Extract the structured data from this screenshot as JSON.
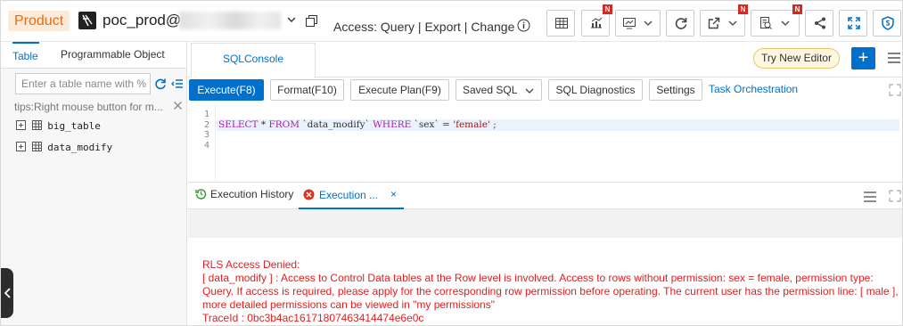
{
  "header": {
    "product_label": "Product",
    "database_name": "poc_prod@",
    "access_label": "Access:",
    "access_value": "Query | Export | Change",
    "new_badge": "N"
  },
  "left_panel": {
    "tabs": [
      "Table",
      "Programmable Object"
    ],
    "search_placeholder": "Enter a table name with %",
    "tips": "tips:Right mouse button for m...",
    "tables": [
      "big_table",
      "data_modify"
    ]
  },
  "editor_tabs": {
    "active_tab": "SQLConsole",
    "try_new_editor": "Try New Editor",
    "add_label": "+"
  },
  "toolbar": {
    "execute": "Execute(F8)",
    "format": "Format(F10)",
    "execute_plan": "Execute Plan(F9)",
    "saved_sql": "Saved SQL",
    "sql_diagnostics": "SQL Diagnostics",
    "settings": "Settings",
    "task_orchestration": "Task Orchestration"
  },
  "editor": {
    "line_numbers": [
      "1",
      "2",
      "3",
      "4"
    ],
    "sql": "SELECT * FROM `data_modify` WHERE `sex` = 'female' ;"
  },
  "result_tabs": {
    "history": "Execution History",
    "execution": "Execution ...",
    "close": "×"
  },
  "result": {
    "lines": [
      "RLS Access Denied:",
      "[ data_modify ] : Access to Control Data tables at the Row level is involved. Access to rows without permission: sex = female, permission type: Query. If access is required, please apply for the corresponding row permission before operating. The current user has the permission line: [ male ], more detailed permissions can be viewed in \"my permissions\"",
      "TraceId : 0bc3b4ac16171807463414474e6e0c"
    ]
  },
  "colors": {
    "accent": "#0070cc",
    "error": "#e02020",
    "product_bg": "#fdebd9",
    "product_text": "#e86a12",
    "badge": "#d9281e"
  }
}
